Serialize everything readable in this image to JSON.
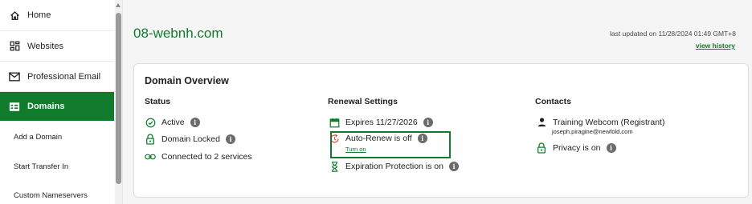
{
  "sidebar": {
    "items": [
      {
        "label": "Home",
        "icon": "home-icon"
      },
      {
        "label": "Websites",
        "icon": "websites-icon"
      },
      {
        "label": "Professional Email",
        "icon": "mail-icon"
      },
      {
        "label": "Domains",
        "icon": "domains-icon",
        "active": true
      }
    ],
    "sub_items": [
      {
        "label": "Add a Domain"
      },
      {
        "label": "Start Transfer In"
      },
      {
        "label": "Custom Nameservers"
      }
    ]
  },
  "header": {
    "domain": "08-webnh.com",
    "last_updated": "last updated on 11/28/2024 01:49 GMT+8",
    "view_history": "view history"
  },
  "overview": {
    "title": "Domain Overview",
    "status": {
      "heading": "Status",
      "items": [
        {
          "label": "Active",
          "icon": "check-circle-icon",
          "info": true
        },
        {
          "label": "Domain Locked",
          "icon": "lock-icon",
          "info": true
        },
        {
          "label": "Connected to 2 services",
          "icon": "link-icon",
          "info": false
        }
      ]
    },
    "renewal": {
      "heading": "Renewal Settings",
      "expires": "Expires 11/27/2026",
      "auto_renew": "Auto-Renew is off",
      "turn_on": "Turn on",
      "expiration_protection": "Expiration Protection is on"
    },
    "contacts": {
      "heading": "Contacts",
      "name": "Training Webcom (Registrant)",
      "email": "joseph.piragine@newfold.com",
      "privacy": "Privacy is on"
    }
  },
  "colors": {
    "brand_green": "#107a2d",
    "warning_red": "#d9534f",
    "info_gray": "#6b6b6b"
  }
}
